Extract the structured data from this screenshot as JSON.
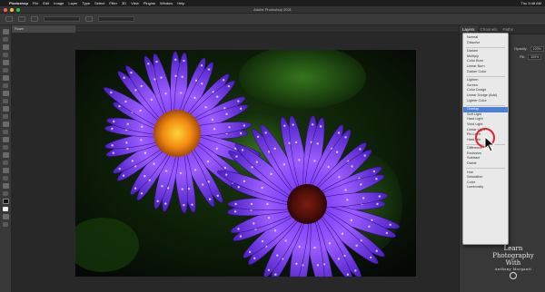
{
  "menubar": {
    "app": "Photoshop",
    "items": [
      "File",
      "Edit",
      "Image",
      "Layer",
      "Type",
      "Select",
      "Filter",
      "3D",
      "View",
      "Plugins",
      "Window",
      "Help"
    ],
    "status_right": "Thu 9:48 AM"
  },
  "titlebar": {
    "title": "Adobe Photoshop 2021"
  },
  "document": {
    "tab_label": "Flower"
  },
  "panel": {
    "tabs": [
      "Layers",
      "Channels",
      "Paths"
    ],
    "search_placeholder": "Kind",
    "opacity_label": "Opacity:",
    "opacity_value": "100%",
    "fill_label": "Fill:",
    "fill_value": "100%",
    "layers": [
      {
        "name": "Group 1"
      },
      {
        "name": "Background"
      }
    ]
  },
  "blend_modes": {
    "groups": [
      [
        "Normal",
        "Dissolve"
      ],
      [
        "Darken",
        "Multiply",
        "Color Burn",
        "Linear Burn",
        "Darker Color"
      ],
      [
        "Lighten",
        "Screen",
        "Color Dodge",
        "Linear Dodge (Add)",
        "Lighter Color"
      ],
      [
        "Overlay",
        "Soft Light",
        "Hard Light",
        "Vivid Light",
        "Linear Light",
        "Pin Light",
        "Hard Mix"
      ],
      [
        "Difference",
        "Exclusion",
        "Subtract",
        "Divide"
      ],
      [
        "Hue",
        "Saturation",
        "Color",
        "Luminosity"
      ]
    ],
    "selected": "Overlay"
  },
  "watermark": {
    "line1": "Learn",
    "line2": "Photography",
    "line3": "With",
    "line4": "Anthony Morganti"
  },
  "colors": {
    "accent": "#4c7fd6",
    "highlight_ring": "#e2202a",
    "canvas_bg": "#282828"
  }
}
